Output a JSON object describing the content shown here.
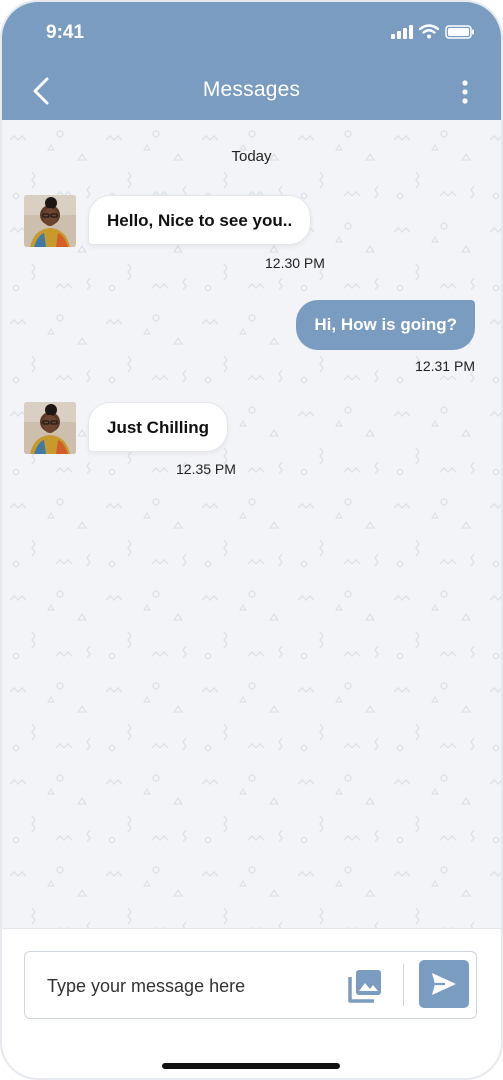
{
  "status_bar": {
    "time": "9:41"
  },
  "header": {
    "title": "Messages"
  },
  "chat": {
    "date_separator": "Today",
    "messages": [
      {
        "direction": "incoming",
        "text": "Hello, Nice to see you..",
        "time": "12.30 PM"
      },
      {
        "direction": "outgoing",
        "text": "Hi, How is going?",
        "time": "12.31 PM"
      },
      {
        "direction": "incoming",
        "text": "Just Chilling",
        "time": "12.35 PM"
      }
    ]
  },
  "composer": {
    "placeholder": "Type your message here"
  },
  "colors": {
    "accent": "#7b9cc1",
    "background": "#f3f4f7",
    "bubble_in": "#ffffff"
  },
  "icons": [
    "back-icon",
    "more-icon",
    "signal-icon",
    "wifi-icon",
    "battery-icon",
    "gallery-icon",
    "send-icon"
  ]
}
